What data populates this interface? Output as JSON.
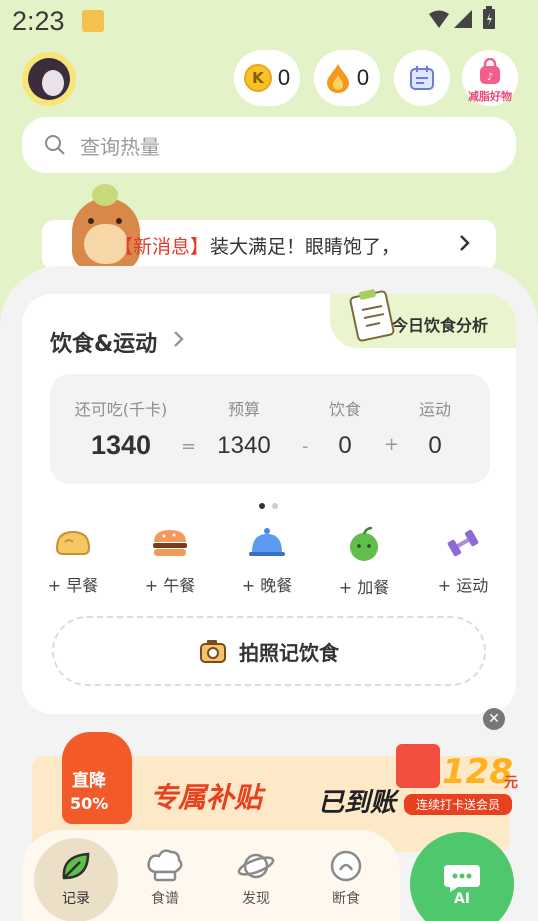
{
  "status_bar": {
    "time": "2:23"
  },
  "header": {
    "coins_k": "0",
    "coins_fire": "0",
    "shop_label": "减脂好物"
  },
  "search": {
    "placeholder": "查询热量"
  },
  "news": {
    "tag": "【新消息】",
    "text": "装大满足！眼睛饱了，"
  },
  "diet_card": {
    "title": "饮食&运动",
    "analysis_label": "今日饮食分析",
    "budget": {
      "remaining_label": "还可吃(千卡)",
      "remaining_value": "1340",
      "budget_label": "预算",
      "budget_value": "1340",
      "diet_label": "饮食",
      "diet_value": "0",
      "exercise_label": "运动",
      "exercise_value": "0",
      "op_equal": "=",
      "op_minus": "-",
      "op_plus": "+"
    },
    "meals": [
      {
        "label": "+ 早餐",
        "icon": "bread-icon"
      },
      {
        "label": "+ 午餐",
        "icon": "burger-icon"
      },
      {
        "label": "+ 晚餐",
        "icon": "cloche-icon"
      },
      {
        "label": "+ 加餐",
        "icon": "apple-icon"
      },
      {
        "label": "+ 运动",
        "icon": "dumbbell-icon"
      }
    ],
    "photo_label": "拍照记饮食"
  },
  "promo": {
    "badge_top": "直降",
    "badge_value": "50%",
    "headline": "专属补贴",
    "headline2": "已到账",
    "amount": "128",
    "amount_unit": "元",
    "sub": "连续打卡送会员"
  },
  "tabbar": {
    "tabs": [
      {
        "label": "记录",
        "icon": "leaf-icon"
      },
      {
        "label": "食谱",
        "icon": "chef-hat-icon"
      },
      {
        "label": "发现",
        "icon": "planet-icon"
      },
      {
        "label": "断食",
        "icon": "fasting-icon"
      }
    ],
    "ai_label": "AI"
  },
  "colors": {
    "accent_green": "#4fc76c",
    "bg_green": "#e4f2c8",
    "news_red": "#e53b2c"
  }
}
